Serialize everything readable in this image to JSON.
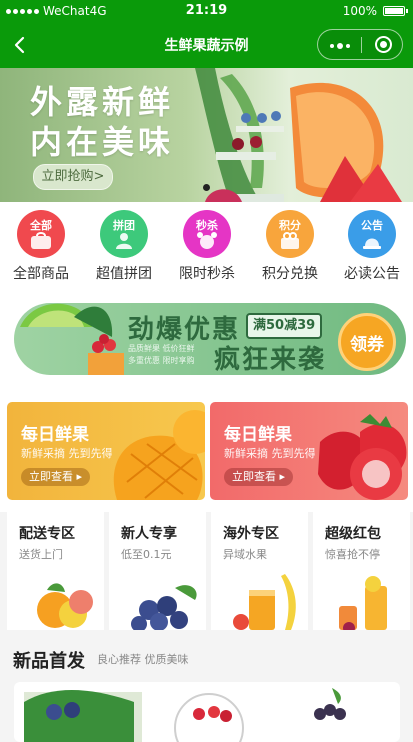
{
  "status_bar": {
    "carrier": "WeChat4G",
    "time": "21:19",
    "battery": "100%"
  },
  "nav": {
    "title": "生鲜果蔬示例"
  },
  "banner": {
    "line1": "外露新鲜",
    "line2": "内在美味",
    "button": "立即抢购>"
  },
  "categories": [
    {
      "tag": "全部",
      "label": "全部商品",
      "color": "#f0494e",
      "icon": "bag-icon"
    },
    {
      "tag": "拼团",
      "label": "超值拼团",
      "color": "#3dc97b",
      "icon": "people-icon"
    },
    {
      "tag": "秒杀",
      "label": "限时秒杀",
      "color": "#e535c5",
      "icon": "alarm-icon"
    },
    {
      "tag": "积分",
      "label": "积分兑换",
      "color": "#f8a53c",
      "icon": "gift-icon"
    },
    {
      "tag": "公告",
      "label": "必读公告",
      "color": "#3a9de8",
      "icon": "bell-icon"
    }
  ],
  "promo": {
    "title": "劲爆优惠",
    "badge": "满50减39",
    "sub1": "品质鲜果 低价狂鲜",
    "sub2": "多重优惠 限时享购",
    "title2": "疯狂来袭",
    "coupon": "领券"
  },
  "fresh_cards": [
    {
      "title": "每日鲜果",
      "sub": "新鲜采摘 先到先得",
      "button": "立即查看 ▸",
      "color": "#f5b233"
    },
    {
      "title": "每日鲜果",
      "sub": "新鲜采摘 先到先得",
      "button": "立即查看 ▸",
      "color": "#f06868"
    }
  ],
  "zones": [
    {
      "title": "配送专区",
      "sub": "送货上门"
    },
    {
      "title": "新人专享",
      "sub": "低至0.1元"
    },
    {
      "title": "海外专区",
      "sub": "异域水果"
    },
    {
      "title": "超级红包",
      "sub": "惊喜抢不停"
    }
  ],
  "new_products": {
    "title": "新品首发",
    "sub": "良心推荐 优质美味"
  },
  "colors": {
    "brand_green": "#0a9a0a"
  }
}
